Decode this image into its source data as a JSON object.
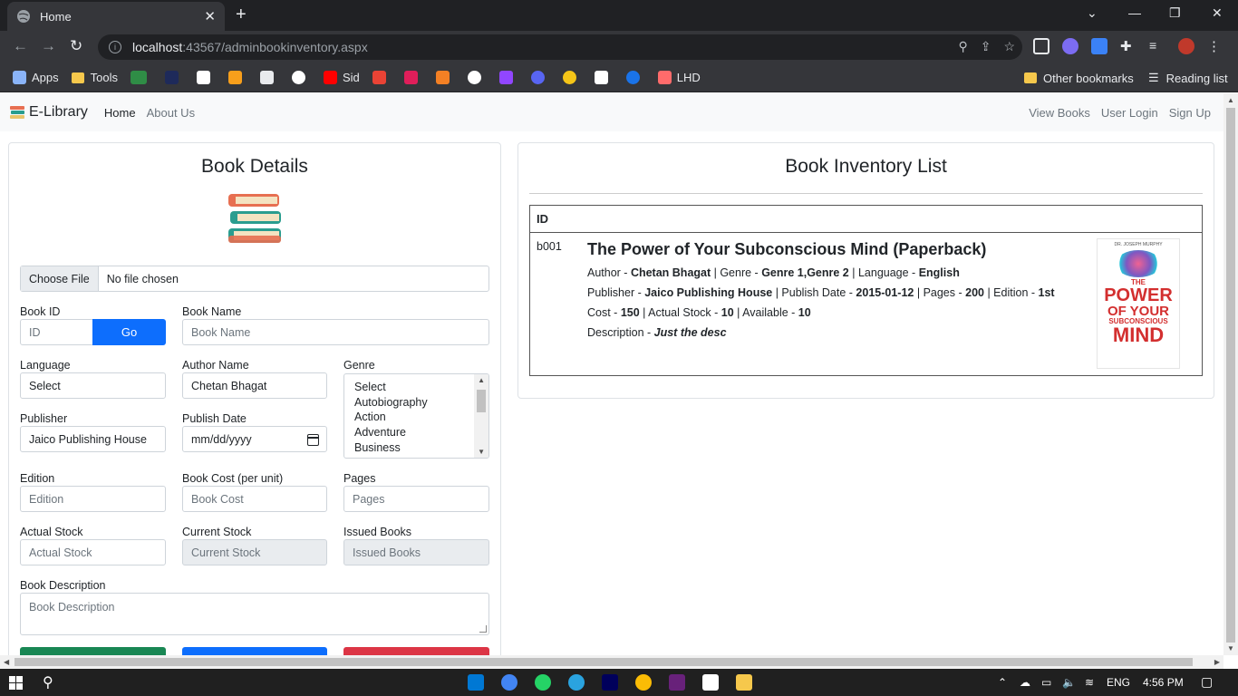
{
  "browser": {
    "tab_title": "Home",
    "url_host": "localhost",
    "url_rest": ":43567/adminbookinventory.aspx",
    "bookmarks": [
      "Apps",
      "Tools",
      "Sid",
      "LHD"
    ],
    "other_bookmarks": "Other bookmarks",
    "reading_list": "Reading list"
  },
  "navbar": {
    "brand": "E-Library",
    "links": [
      "Home",
      "About Us"
    ],
    "right_links": [
      "View Books",
      "User Login",
      "Sign Up"
    ]
  },
  "book_details": {
    "title": "Book Details",
    "file_button": "Choose File",
    "file_text": "No file chosen",
    "book_id_label": "Book ID",
    "book_id_placeholder": "ID",
    "go_label": "Go",
    "book_name_label": "Book Name",
    "book_name_placeholder": "Book Name",
    "language_label": "Language",
    "language_value": "Select",
    "author_label": "Author Name",
    "author_value": "Chetan Bhagat",
    "genre_label": "Genre",
    "genre_options": [
      "Select",
      "Autobiography",
      "Action",
      "Adventure",
      "Business"
    ],
    "publisher_label": "Publisher",
    "publisher_value": "Jaico Publishing House",
    "publish_date_label": "Publish Date",
    "publish_date_value": "mm/dd/yyyy",
    "edition_label": "Edition",
    "edition_placeholder": "Edition",
    "cost_label": "Book Cost (per unit)",
    "cost_placeholder": "Book Cost",
    "pages_label": "Pages",
    "pages_placeholder": "Pages",
    "actual_stock_label": "Actual Stock",
    "actual_stock_placeholder": "Actual Stock",
    "current_stock_label": "Current Stock",
    "current_stock_placeholder": "Current Stock",
    "issued_label": "Issued Books",
    "issued_placeholder": "Issued Books",
    "description_label": "Book Description",
    "description_placeholder": "Book Description"
  },
  "inventory": {
    "title": "Book Inventory List",
    "column_id": "ID",
    "book": {
      "id": "b001",
      "title": "The Power of Your Subconscious Mind (Paperback)",
      "author": "Chetan Bhagat",
      "genre": "Genre 1,Genre 2",
      "language": "English",
      "publisher": "Jaico Publishing House",
      "publish_date": "2015-01-12",
      "pages": "200",
      "edition": "1st",
      "cost": "150",
      "actual_stock": "10",
      "available": "10",
      "description": "Just the desc",
      "cover_author": "DR. JOSEPH MURPHY",
      "cover_title": [
        "THE",
        "POWER",
        "OF YOUR",
        "SUBCONSCIOUS",
        "MIND"
      ]
    },
    "labels": {
      "author": "Author - ",
      "genre": " | Genre - ",
      "language": " | Language - ",
      "publisher": "Publisher - ",
      "publish_date": " | Publish Date - ",
      "pages": " | Pages - ",
      "edition": " | Edition - ",
      "cost": "Cost - ",
      "actual_stock": " | Actual Stock - ",
      "available": " | Available - ",
      "description": "Description - "
    }
  },
  "taskbar": {
    "language": "ENG",
    "time": "4:56 PM"
  },
  "colors": {
    "primary": "#0d6efd",
    "success": "#198754",
    "danger": "#dc3545"
  }
}
